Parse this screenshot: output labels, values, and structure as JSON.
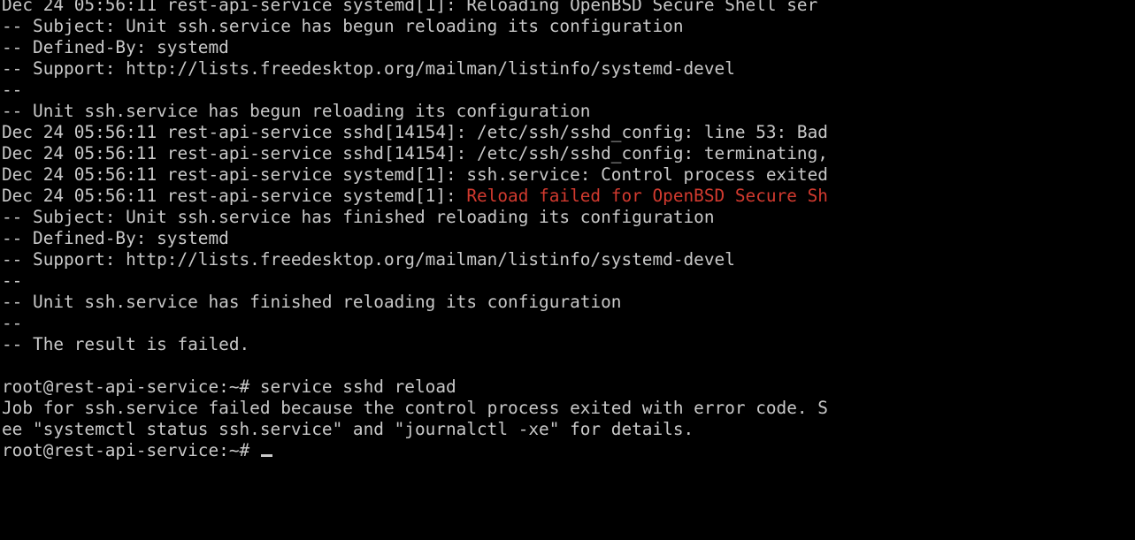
{
  "terminal": {
    "lines": [
      {
        "text": "Dec 24 05:56:11 rest-api-service systemd[1]: Reloading OpenBSD Secure Shell ser"
      },
      {
        "text": "-- Subject: Unit ssh.service has begun reloading its configuration"
      },
      {
        "text": "-- Defined-By: systemd"
      },
      {
        "text": "-- Support: http://lists.freedesktop.org/mailman/listinfo/systemd-devel"
      },
      {
        "text": "--"
      },
      {
        "text": "-- Unit ssh.service has begun reloading its configuration"
      },
      {
        "text": "Dec 24 05:56:11 rest-api-service sshd[14154]: /etc/ssh/sshd_config: line 53: Bad"
      },
      {
        "text": "Dec 24 05:56:11 rest-api-service sshd[14154]: /etc/ssh/sshd_config: terminating,"
      },
      {
        "text": "Dec 24 05:56:11 rest-api-service systemd[1]: ssh.service: Control process exited"
      },
      {
        "text": "Dec 24 05:56:11 rest-api-service systemd[1]: ",
        "highlight": "Reload failed for OpenBSD Secure Sh"
      },
      {
        "text": "-- Subject: Unit ssh.service has finished reloading its configuration"
      },
      {
        "text": "-- Defined-By: systemd"
      },
      {
        "text": "-- Support: http://lists.freedesktop.org/mailman/listinfo/systemd-devel"
      },
      {
        "text": "--"
      },
      {
        "text": "-- Unit ssh.service has finished reloading its configuration"
      },
      {
        "text": "--"
      },
      {
        "text": "-- The result is failed."
      },
      {
        "text": ""
      },
      {
        "text": "root@rest-api-service:~# service sshd reload"
      },
      {
        "text": "Job for ssh.service failed because the control process exited with error code. S"
      },
      {
        "text": "ee \"systemctl status ssh.service\" and \"journalctl -xe\" for details."
      }
    ],
    "prompt": "root@rest-api-service:~# ",
    "colors": {
      "background": "#000000",
      "foreground": "#c8c8c8",
      "error": "#d23a2f"
    }
  }
}
